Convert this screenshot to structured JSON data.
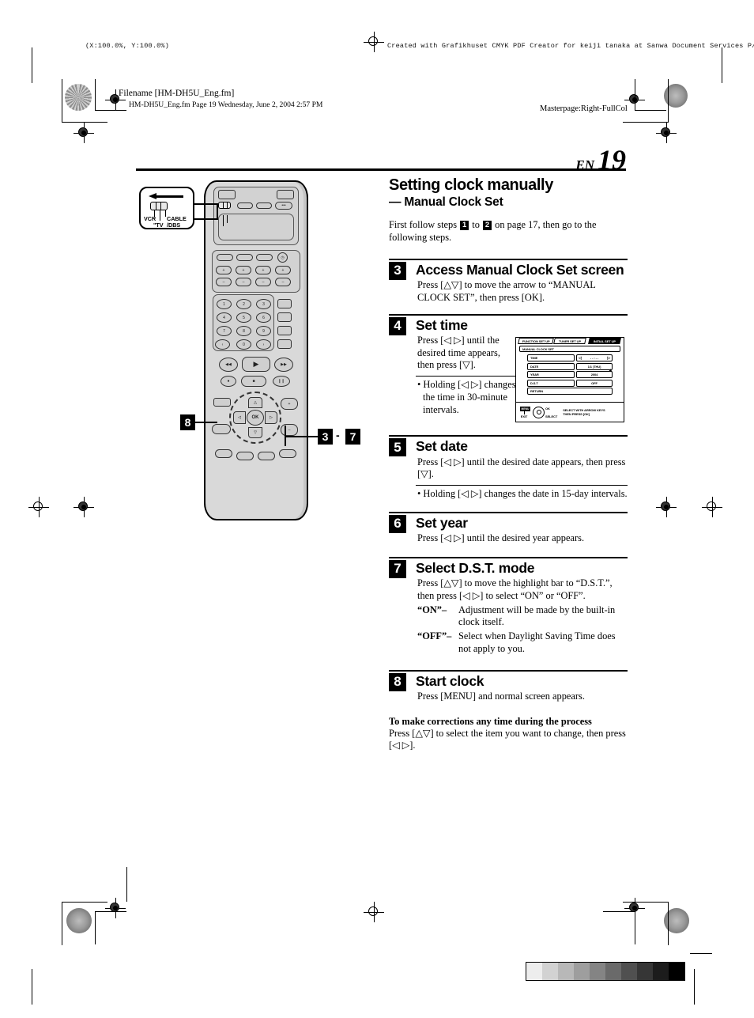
{
  "print_marks": {
    "scale_note": "(X:100.0%, Y:100.0%)",
    "creator_note": "Created with Grafikhuset CMYK PDF Creator for keiji tanaka at Sanwa Document Services P/L.",
    "filename_label": "Filename [HM-DH5U_Eng.fm]",
    "file_stamp": "HM-DH5U_Eng.fm  Page 19  Wednesday, June 2, 2004  2:57 PM",
    "masterpage": "Masterpage:Right-FullCol",
    "grayscale_swatches": [
      "#ededed",
      "#d2d2d2",
      "#b8b8b8",
      "#9e9e9e",
      "#848484",
      "#6a6a6a",
      "#505050",
      "#363636",
      "#1c1c1c",
      "#000000"
    ]
  },
  "header": {
    "lang_code": "EN",
    "page_number": "19"
  },
  "section": {
    "title": "Setting clock manually",
    "subtitle": "— Manual Clock Set",
    "intro_a": "First follow steps",
    "intro_step_from": "1",
    "intro_b": "to",
    "intro_step_to": "2",
    "intro_c": "on page 17, then go to the",
    "intro_d": "following steps."
  },
  "steps": [
    {
      "number": "3",
      "title": "Access Manual Clock Set screen",
      "text": "Press [△▽] to move the arrow to “MANUAL CLOCK SET”, then press [OK]."
    },
    {
      "number": "4",
      "title": "Set time",
      "text": "Press [◁ ▷] until the desired time appears, then press [▽].",
      "bullet": "• Holding [◁ ▷] changes the time in 30-minute intervals."
    },
    {
      "number": "5",
      "title": "Set date",
      "text": "Press [◁ ▷] until the desired date appears, then press [▽].",
      "bullet": "• Holding [◁ ▷] changes the date in 15-day intervals."
    },
    {
      "number": "6",
      "title": "Set year",
      "text": "Press [◁ ▷] until the desired year appears."
    },
    {
      "number": "7",
      "title": "Select D.S.T. mode",
      "text": "Press [△▽] to move the highlight bar to “D.S.T.”, then press [◁ ▷] to select “ON” or “OFF”.",
      "def_on_term": "“ON”–",
      "def_on_desc": "Adjustment will be made by the built-in clock itself.",
      "def_off_term": "“OFF”–",
      "def_off_desc": "Select when Daylight Saving Time does not apply to you."
    },
    {
      "number": "8",
      "title": "Start clock",
      "text": "Press [MENU] and normal screen appears."
    }
  ],
  "corrections": {
    "heading": "To make corrections any time during the process",
    "text": "Press [△▽] to select the item you want to change, then press [◁ ▷]."
  },
  "osd": {
    "tabs": [
      {
        "label": "FUNCTION SET UP",
        "active": false
      },
      {
        "label": "TUNER SET UP",
        "active": false
      },
      {
        "label": "INITIAL SET UP",
        "active": true
      }
    ],
    "screen_title": "MANUAL CLOCK SET",
    "rows": [
      {
        "label": "TIME",
        "value": "- - : - -",
        "arrows": true
      },
      {
        "label": "DATE",
        "value": "1/1 (THU)",
        "arrows": false
      },
      {
        "label": "YEAR",
        "value": "2004",
        "arrows": false
      },
      {
        "label": "D.S.T",
        "value": "OFF",
        "arrows": false
      }
    ],
    "return_label": "RETURN",
    "footer": {
      "menu_btn": "MENU",
      "exit_label": "EXIT",
      "ok_label": "OK",
      "select_label": "SELECT",
      "hint_line1": "SELECT WITH ARROW KEYS",
      "hint_line2": "THEN PRESS [OK]"
    }
  },
  "remote": {
    "callout": {
      "left_label": "VCR",
      "center_label": "TV",
      "right_label_top": "CABLE",
      "right_label_bottom": "/DBS",
      "center_prefix": "\""
    },
    "markers": {
      "menu_marker": "8",
      "range_from": "3",
      "range_dash": "-",
      "range_to": "7"
    },
    "keypad": [
      "1",
      "2",
      "3",
      "4",
      "5",
      "6",
      "7",
      "8",
      "9",
      "0"
    ],
    "ok_label": "OK"
  }
}
